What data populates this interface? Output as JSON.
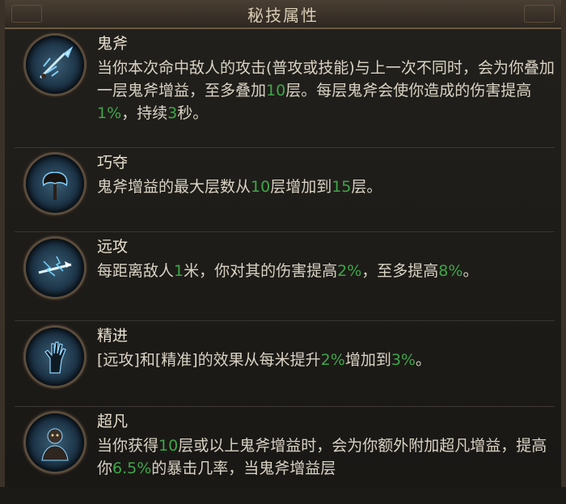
{
  "header": {
    "title": "秘技属性"
  },
  "colors": {
    "highlight": "#3fa64a",
    "text": "#d9d3c4",
    "name": "#e9e1cf"
  },
  "skills": [
    {
      "icon": "ghost-axe-icon",
      "name": "鬼斧",
      "desc": [
        {
          "t": "当你本次命中敌人的攻击(普攻或技能)与上一次不同时，会为你叠加一层鬼斧增益，至多叠加"
        },
        {
          "t": "10",
          "hl": true
        },
        {
          "t": "层。每层鬼斧会使你造成的伤害提高"
        },
        {
          "t": "1%",
          "hl": true
        },
        {
          "t": "，持续"
        },
        {
          "t": "3",
          "hl": true
        },
        {
          "t": "秒。"
        }
      ]
    },
    {
      "icon": "battle-axe-icon",
      "name": "巧夺",
      "desc": [
        {
          "t": "鬼斧增益的最大层数从"
        },
        {
          "t": "10",
          "hl": true
        },
        {
          "t": "层增加到"
        },
        {
          "t": "15",
          "hl": true
        },
        {
          "t": "层。"
        }
      ]
    },
    {
      "icon": "lightning-spear-icon",
      "name": "远攻",
      "desc": [
        {
          "t": "每距离敌人"
        },
        {
          "t": "1",
          "hl": true
        },
        {
          "t": "米，你对其的伤害提高"
        },
        {
          "t": "2%",
          "hl": true
        },
        {
          "t": "，至多提高"
        },
        {
          "t": "8%",
          "hl": true
        },
        {
          "t": "。"
        }
      ]
    },
    {
      "icon": "raised-hand-icon",
      "name": "精进",
      "desc": [
        {
          "t": "[远攻]和[精准]的效果从每米提升"
        },
        {
          "t": "2%",
          "hl": true
        },
        {
          "t": "增加到"
        },
        {
          "t": "3%",
          "hl": true
        },
        {
          "t": "。"
        }
      ]
    },
    {
      "icon": "transcendent-figure-icon",
      "name": "超凡",
      "desc": [
        {
          "t": "当你获得"
        },
        {
          "t": "10",
          "hl": true
        },
        {
          "t": "层或以上鬼斧增益时，会为你额外附加超凡增益，提高你"
        },
        {
          "t": "6.5%",
          "hl": true
        },
        {
          "t": "的暴击几率，当鬼斧增益层"
        }
      ]
    }
  ]
}
